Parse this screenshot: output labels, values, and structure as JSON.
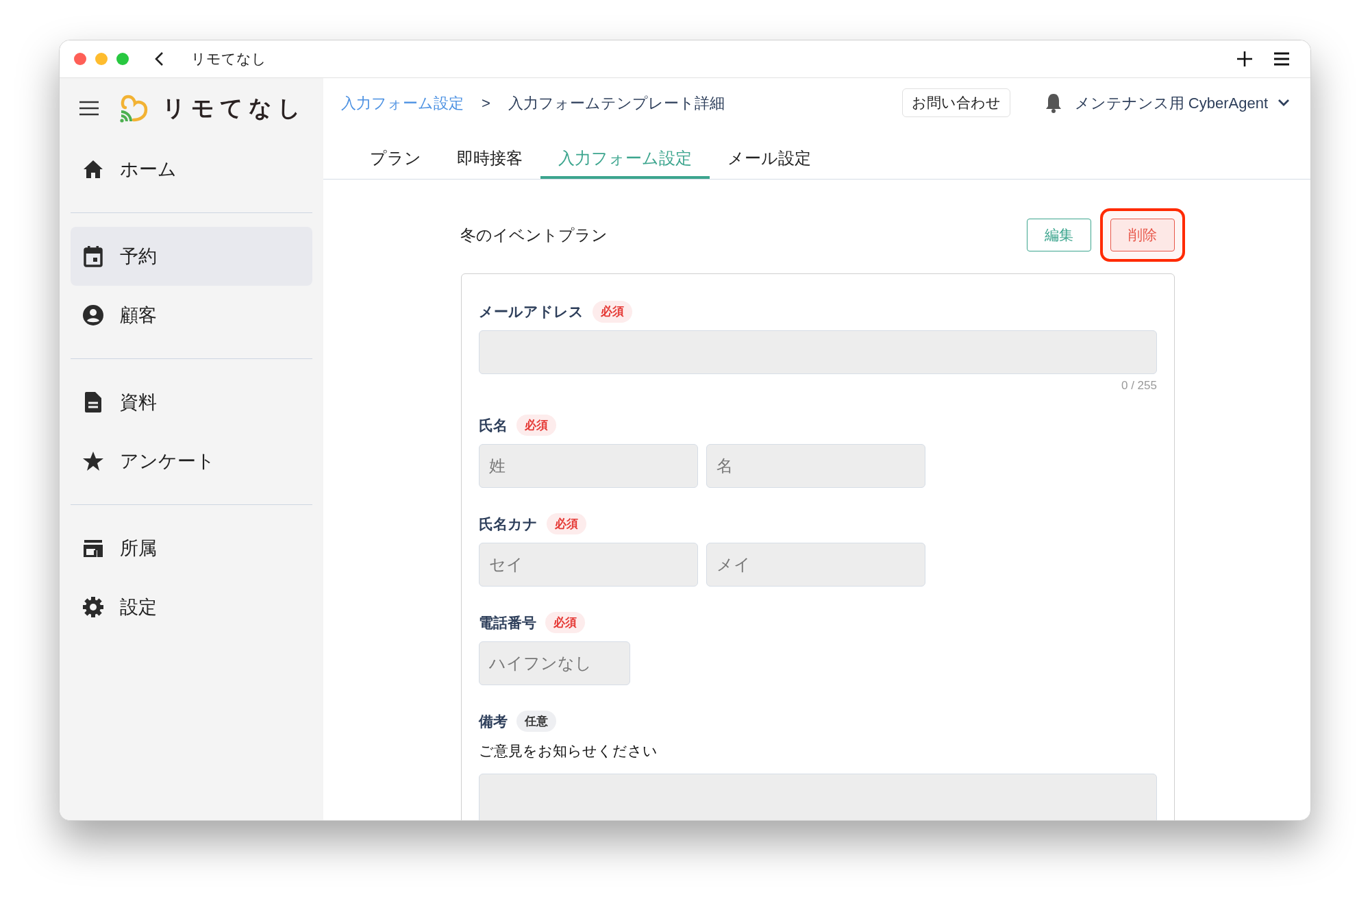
{
  "window": {
    "title": "リモてなし"
  },
  "sidebar": {
    "logo": "リモてなし",
    "groups": [
      [
        {
          "label": "ホーム",
          "selected": false
        }
      ],
      [
        {
          "label": "予約",
          "selected": true
        },
        {
          "label": "顧客",
          "selected": false
        }
      ],
      [
        {
          "label": "資料",
          "selected": false
        },
        {
          "label": "アンケート",
          "selected": false
        }
      ],
      [
        {
          "label": "所属",
          "selected": false
        },
        {
          "label": "設定",
          "selected": false
        }
      ]
    ]
  },
  "header": {
    "breadcrumb": [
      {
        "label": "入力フォーム設定",
        "link": true
      },
      {
        "label": ">",
        "link": false
      },
      {
        "label": "入力フォームテンプレート詳細",
        "link": false
      }
    ],
    "contact_button": "お問い合わせ",
    "user": "メンテナンス用 CyberAgent"
  },
  "tabs": [
    {
      "label": "プラン",
      "selected": false
    },
    {
      "label": "即時接客",
      "selected": false
    },
    {
      "label": "入力フォーム設定",
      "selected": true
    },
    {
      "label": "メール設定",
      "selected": false
    }
  ],
  "template": {
    "title": "冬のイベントプラン",
    "buttons": [
      {
        "label": "編集",
        "kind": "edit",
        "highlighted": false
      },
      {
        "label": "削除",
        "kind": "delete",
        "highlighted": true
      }
    ]
  },
  "form": {
    "fields": [
      {
        "label": "メールアドレス",
        "badge": "必須",
        "required": true,
        "kind": "wide",
        "counter": "0 / 255"
      },
      {
        "label": "氏名",
        "badge": "必須",
        "required": true,
        "kind": "pair",
        "placeholders": [
          "姓",
          "名"
        ]
      },
      {
        "label": "氏名カナ",
        "badge": "必須",
        "required": true,
        "kind": "pair",
        "placeholders": [
          "セイ",
          "メイ"
        ]
      },
      {
        "label": "電話番号",
        "badge": "必須",
        "required": true,
        "kind": "short",
        "placeholder": "ハイフンなし"
      },
      {
        "label": "備考",
        "badge": "任意",
        "required": false,
        "kind": "textarea",
        "description": "ご意見をお知らせください"
      }
    ]
  }
}
